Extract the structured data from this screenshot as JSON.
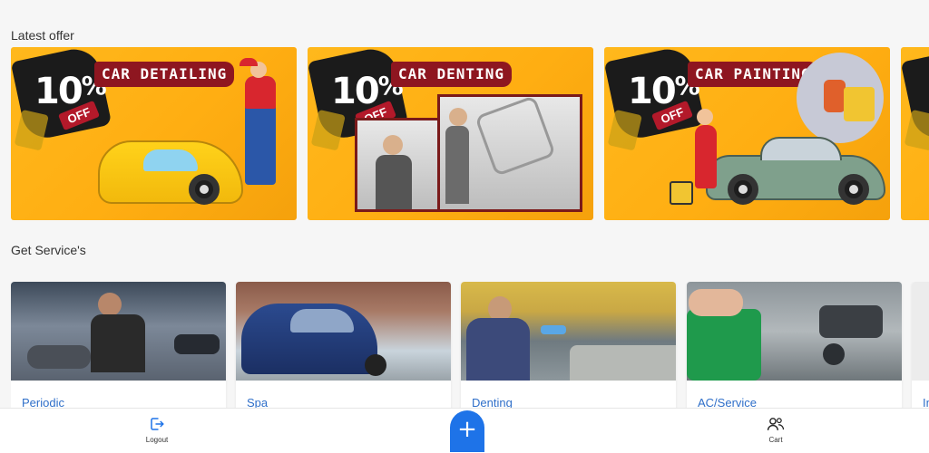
{
  "sections": {
    "latest_offer": "Latest offer",
    "get_services": "Get Service's"
  },
  "offers": [
    {
      "percent": "10",
      "percent_sign": "%",
      "off": "OFF",
      "title": "CAR DETAILING"
    },
    {
      "percent": "10",
      "percent_sign": "%",
      "off": "OFF",
      "title": "CAR DENTING"
    },
    {
      "percent": "10",
      "percent_sign": "%",
      "off": "OFF",
      "title": "CAR PAINTING"
    }
  ],
  "services": [
    {
      "label": "Periodic"
    },
    {
      "label": "Spa"
    },
    {
      "label": "Denting"
    },
    {
      "label": "AC/Service"
    },
    {
      "label": "In"
    }
  ],
  "nav": {
    "logout": "Logout",
    "fab": "+",
    "cart": "Cart"
  },
  "colors": {
    "accent": "#1e73e8",
    "offer_bg": "#ffb81c",
    "ribbon": "#8e1620",
    "service_label": "#2f6fc9"
  }
}
